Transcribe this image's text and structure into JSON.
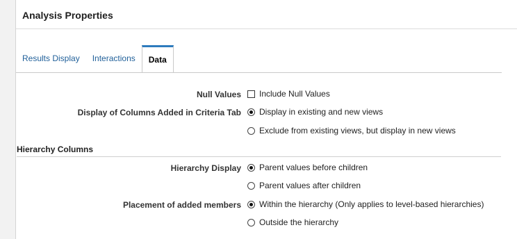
{
  "dialog": {
    "title": "Analysis Properties"
  },
  "tabs": [
    {
      "label": "Results Display",
      "selected": false
    },
    {
      "label": "Interactions",
      "selected": false
    },
    {
      "label": "Data",
      "selected": true
    }
  ],
  "form": {
    "null_values": {
      "label": "Null Values",
      "checkbox_label": "Include Null Values",
      "checked": false
    },
    "columns_added": {
      "label": "Display of Columns Added in Criteria Tab",
      "options": [
        {
          "label": "Display in existing and new views",
          "selected": true
        },
        {
          "label": "Exclude from existing views, but display in new views",
          "selected": false
        }
      ]
    },
    "hierarchy_section": {
      "title": "Hierarchy Columns"
    },
    "hierarchy_display": {
      "label": "Hierarchy Display",
      "options": [
        {
          "label": "Parent values before children",
          "selected": true
        },
        {
          "label": "Parent values after children",
          "selected": false
        }
      ]
    },
    "placement": {
      "label": "Placement of added members",
      "options": [
        {
          "label": "Within the hierarchy (Only applies to level-based hierarchies)",
          "selected": true
        },
        {
          "label": "Outside the hierarchy",
          "selected": false
        }
      ]
    }
  }
}
